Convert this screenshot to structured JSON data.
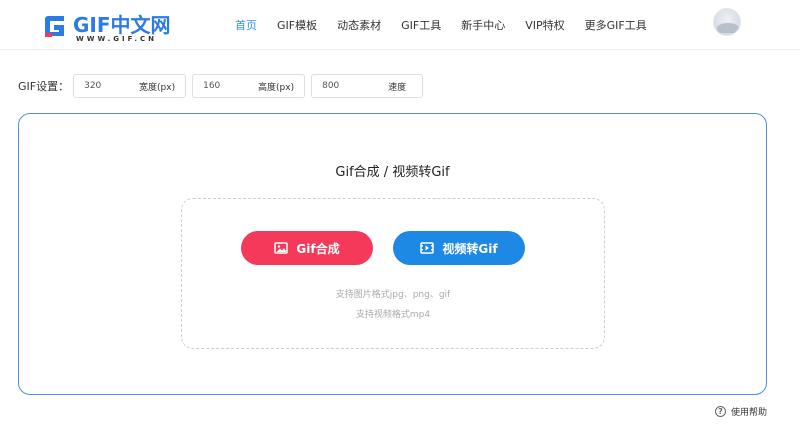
{
  "header": {
    "logo_text": "GIF中文网",
    "logo_sub": "WWW.GIF.CN",
    "nav": [
      {
        "label": "首页",
        "active": true
      },
      {
        "label": "GIF模板",
        "active": false
      },
      {
        "label": "动态素材",
        "active": false
      },
      {
        "label": "GIF工具",
        "active": false
      },
      {
        "label": "新手中心",
        "active": false
      },
      {
        "label": "VIP特权",
        "active": false
      },
      {
        "label": "更多GIF工具",
        "active": false
      }
    ]
  },
  "settings": {
    "label": "GIF设置：",
    "width": {
      "value": "320",
      "unit": "宽度(px)"
    },
    "height": {
      "value": "160",
      "unit": "高度(px)"
    },
    "speed": {
      "value": "800",
      "unit": "速度"
    }
  },
  "main": {
    "title": "Gif合成 / 视频转Gif",
    "gif_button": "Gif合成",
    "video_button": "视频转Gif",
    "hint_image": "支持图片格式jpg、png、gif",
    "hint_video": "支持视频格式mp4"
  },
  "help": {
    "icon_glyph": "?",
    "label": "使用帮助"
  },
  "colors": {
    "accent": "#2c8ef8",
    "gif_button": "#f4395a",
    "video_button": "#1e88e5",
    "card_border": "#4a90e2"
  }
}
